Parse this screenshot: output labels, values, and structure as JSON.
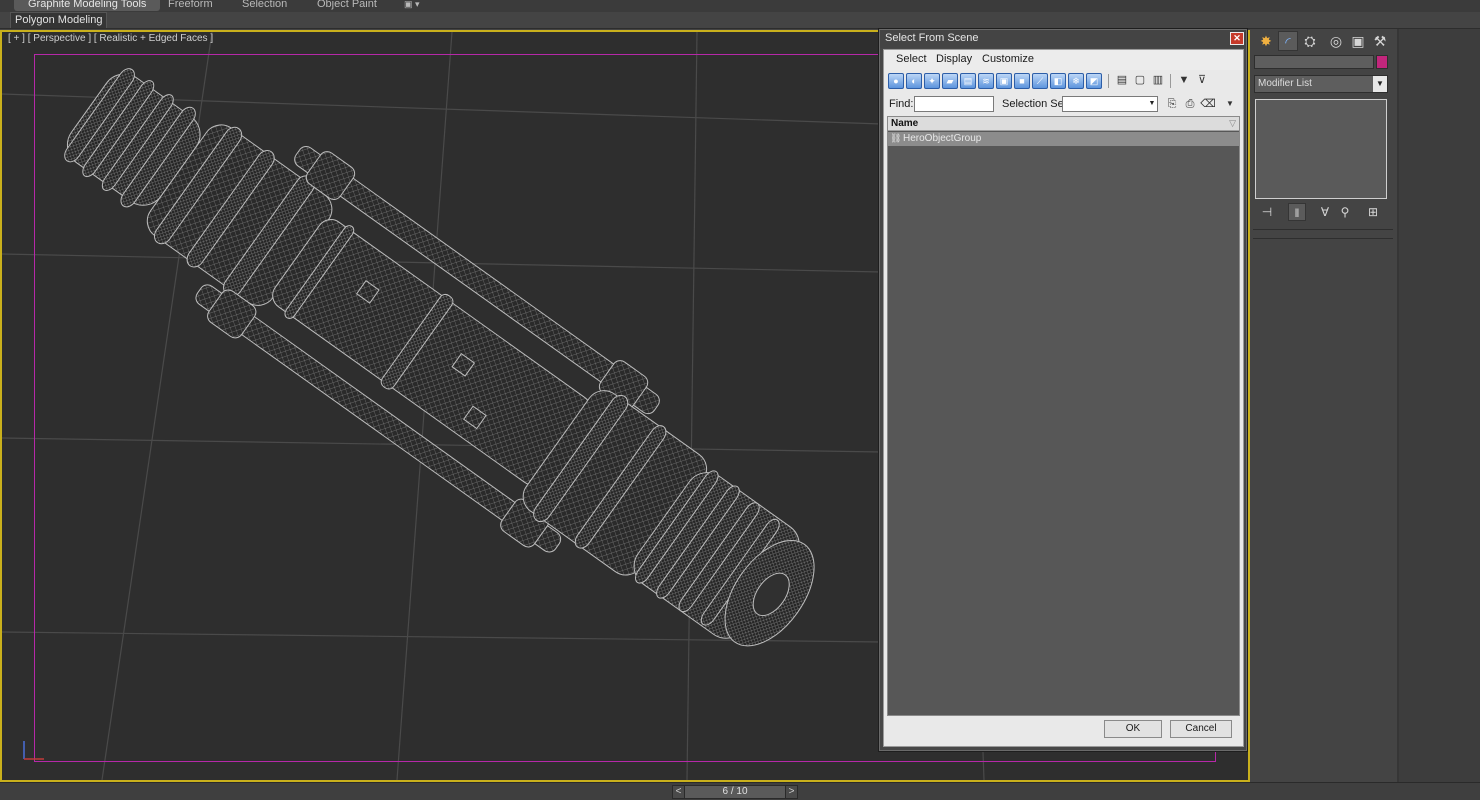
{
  "ribbon": {
    "tabs": [
      {
        "label": "Graphite Modeling Tools",
        "active": true
      },
      {
        "label": "Freeform",
        "active": false
      },
      {
        "label": "Selection",
        "active": false
      },
      {
        "label": "Object Paint",
        "active": false
      }
    ],
    "extra_icon": "ribbon-options-icon",
    "panel_tab": "Polygon Modeling"
  },
  "viewport": {
    "label": "[ + ] [ Perspective ] [ Realistic + Edged Faces ]",
    "active_border_color": "#c9b01c",
    "safe_frame_color": "#b628a8",
    "model_icon": "wireframe-cylinder-model"
  },
  "time_slider": {
    "prev": "<",
    "position": "6 / 10",
    "next": ">"
  },
  "command_panel": {
    "tabs": [
      "create-icon",
      "modify-icon",
      "hierarchy-icon",
      "motion-icon",
      "display-icon",
      "utilities-icon"
    ],
    "object_name": "",
    "object_color": "#c2267c",
    "modifier_list": "Modifier List",
    "stack_tools": [
      "pin-stack-icon",
      "show-end-result-icon",
      "make-unique-icon",
      "remove-modifier-icon",
      "configure-modifier-sets-icon"
    ]
  },
  "dialog": {
    "title": "Select From Scene",
    "close_icon": "close-icon",
    "menu": [
      "Select",
      "Display",
      "Customize"
    ],
    "toolbar_icons": [
      "display-geometry-icon",
      "display-shapes-icon",
      "display-lights-icon",
      "display-cameras-icon",
      "display-helpers-icon",
      "display-spacewarps-icon",
      "display-groups-icon",
      "display-xrefs-icon",
      "display-bones-icon",
      "display-containers-icon",
      "display-frozen-icon",
      "display-hidden-icon",
      "display-all-icon",
      "display-none-icon",
      "invert-display-icon",
      "select-all-icon",
      "select-none-icon",
      "select-invert-icon",
      "filter-icon",
      "sync-selection-icon"
    ],
    "find_label": "Find:",
    "find_value": "",
    "selection_set_label": "Selection Set:",
    "selection_set_value": "",
    "findbar_icons": [
      "edit-selection-set-icon",
      "create-selection-set-icon",
      "remove-selection-set-icon",
      "more-icon"
    ],
    "column_header": "Name",
    "rows": [
      {
        "label": "HeroObjectGroup",
        "icon": "group-icon",
        "selected": true
      }
    ],
    "ok": "OK",
    "cancel": "Cancel"
  }
}
